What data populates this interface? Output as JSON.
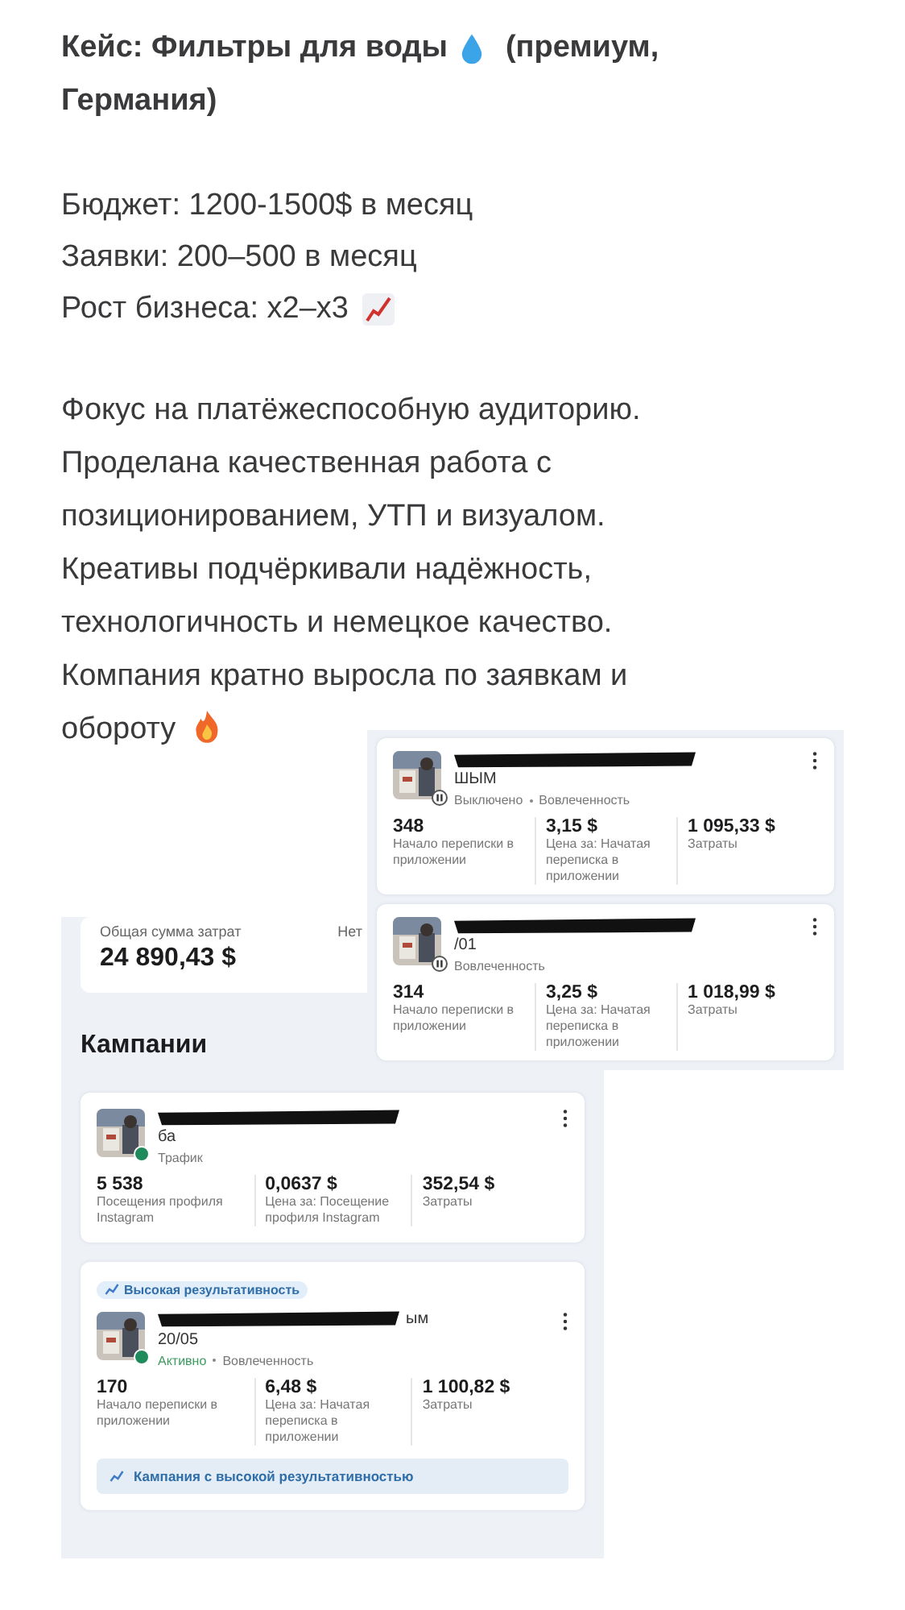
{
  "heading": {
    "text": "Кейс: Фильтры для воды",
    "text_2": "(премиум,",
    "text_3": "Германия)"
  },
  "facts": [
    "Бюджет: 1200-1500$ в месяц",
    "Заявки: 200–500 в месяц",
    "Рост бизнеса: x2–x3"
  ],
  "body": {
    "text": "Фокус на платёжеспособную аудиторию.\nПроделана качественная работа с\nпозиционированием, УТП и визуалом.\nКреативы подчёркивали надёжность,\nтехнологичность и немецкое качество.\nКомпания кратно выросла по заявкам и",
    "last_line": "обороту"
  },
  "ads_screen": {
    "summary": {
      "label": "Общая сумма затрат",
      "value": "24 890,43 $",
      "label_2": "Нет"
    },
    "section_title": "Кампании",
    "campaigns": [
      {
        "title_line2": "ба",
        "kind": "active",
        "objective": "Трафик",
        "metrics": [
          {
            "value": "5 538",
            "label": "Посещения профиля Instagram"
          },
          {
            "value": "0,0637 $",
            "label": "Цена за: Посещение профиля Instagram"
          },
          {
            "value": "352,54 $",
            "label": "Затраты"
          }
        ]
      },
      {
        "badge": "Высокая результативность",
        "title_visible": "ым",
        "title_line2": "20/05",
        "status": "Активно",
        "kind": "active",
        "objective": "Вовлеченность",
        "metrics": [
          {
            "value": "170",
            "label": "Начало переписки в приложении"
          },
          {
            "value": "6,48 $",
            "label": "Цена за: Начатая переписка в приложении"
          },
          {
            "value": "1 100,82 $",
            "label": "Затраты"
          }
        ],
        "banner": "Кампания с высокой результативностью"
      }
    ]
  },
  "overlay_screen": {
    "campaigns": [
      {
        "title_line2": "ШЫМ",
        "status": "Выключено",
        "kind": "off",
        "objective": "Вовлеченность",
        "metrics": [
          {
            "value": "348",
            "label": "Начало переписки в приложении"
          },
          {
            "value": "3,15 $",
            "label": "Цена за: Начатая переписка в приложении"
          },
          {
            "value": "1 095,33 $",
            "label": "Затраты"
          }
        ]
      },
      {
        "title_line2": "/01",
        "kind": "off",
        "objective": "Вовлеченность",
        "metrics": [
          {
            "value": "314",
            "label": "Начало переписки в приложении"
          },
          {
            "value": "3,25 $",
            "label": "Цена за: Начатая переписка в приложении"
          },
          {
            "value": "1 018,99 $",
            "label": "Затраты"
          }
        ]
      }
    ]
  }
}
